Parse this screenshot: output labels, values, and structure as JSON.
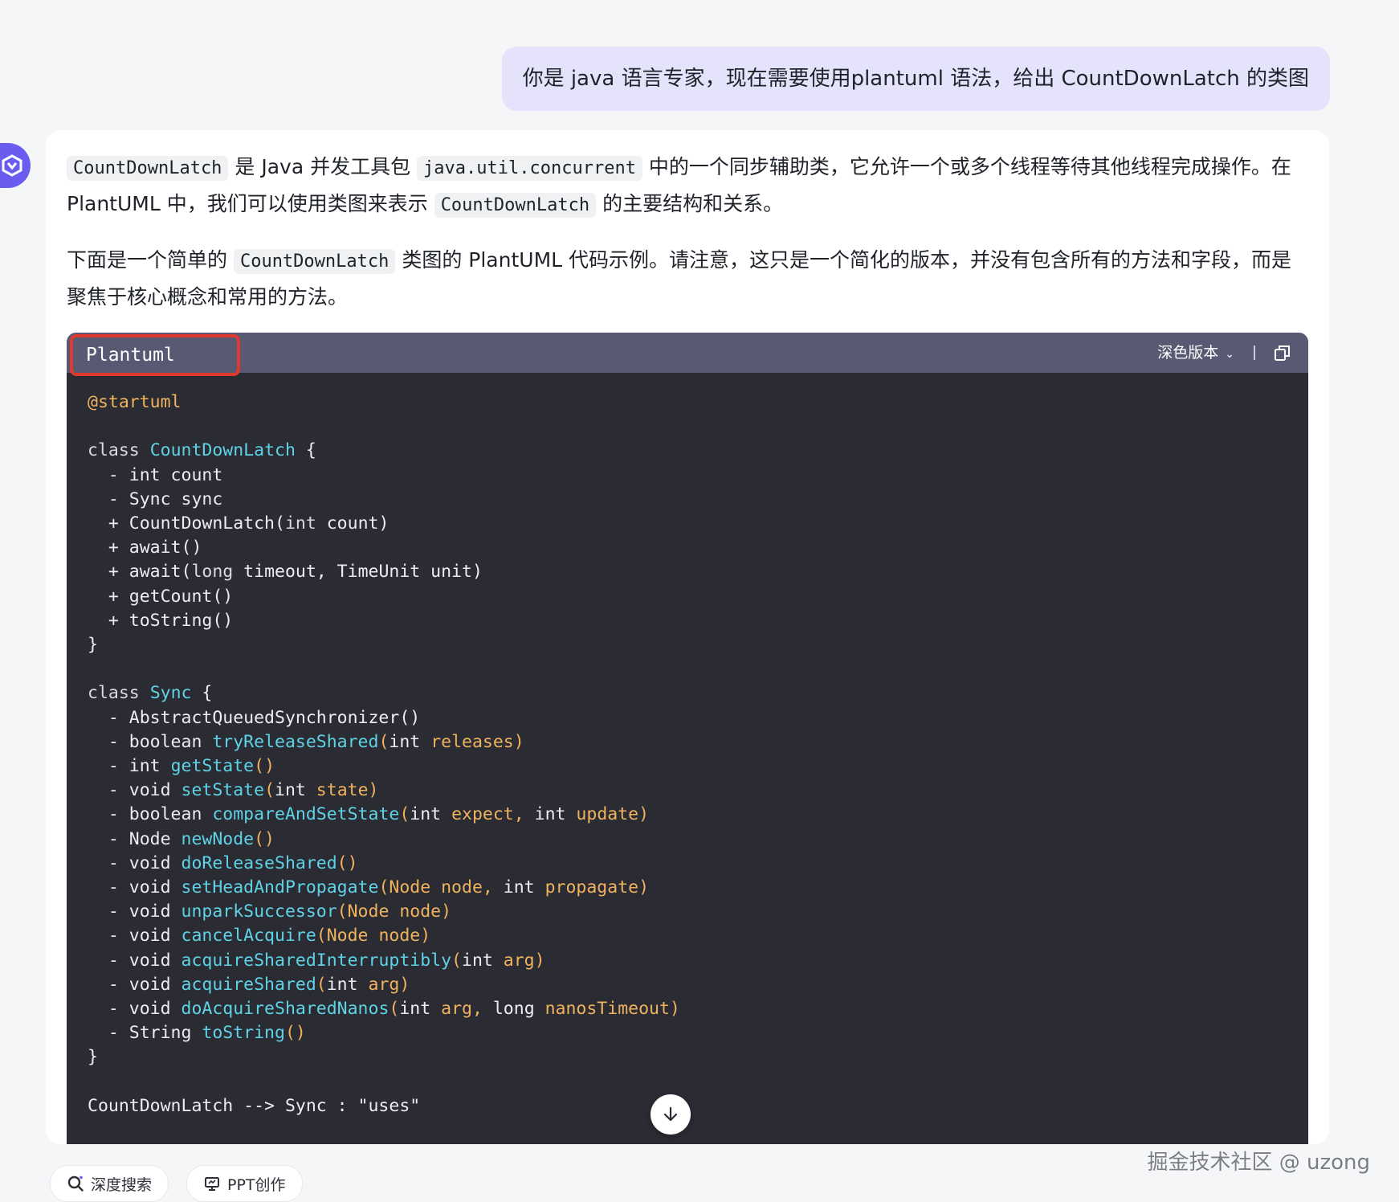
{
  "user_message": "你是 java 语言专家，现在需要使用plantuml 语法，给出 CountDownLatch 的类图",
  "answer": {
    "para1": {
      "code1": "CountDownLatch",
      "text1": " 是 Java 并发工具包 ",
      "code2": "java.util.concurrent",
      "text2": " 中的一个同步辅助类，它允许一个或多个线程等待其他线程完成操作。在 PlantUML 中，我们可以使用类图来表示 ",
      "code3": "CountDownLatch",
      "text3": " 的主要结构和关系。"
    },
    "para2": {
      "text1": "下面是一个简单的 ",
      "code1": "CountDownLatch",
      "text2": " 类图的 PlantUML 代码示例。请注意，这只是一个简化的版本，并没有包含所有的方法和字段，而是聚焦于核心概念和常用的方法。"
    }
  },
  "code_block": {
    "language": "Plantuml",
    "theme_label": "深色版本",
    "lines": {
      "startuml": "@startuml",
      "kw_class": "class",
      "cdl_name": "CountDownLatch",
      "sync_name": "Sync",
      "open_brace": " {",
      "close_brace": "}",
      "l_int_count": "  - int count",
      "l_sync_sync": "  - Sync sync",
      "l_ctor_a": "  + CountDownLatch(",
      "l_ctor_int": "int",
      "l_ctor_b": " count)",
      "l_await": "  + await()",
      "l_await2_a": "  + await(",
      "l_await2_long": "long",
      "l_await2_b": " timeout, TimeUnit unit)",
      "l_getcount": "  + getCount()",
      "l_tostring": "  + toString()",
      "s_aqs": "  - AbstractQueuedSynchronizer()",
      "s_trs_ret": "  - boolean ",
      "s_trs_fn": "tryReleaseShared",
      "s_trs_p1": "(",
      "s_trs_type": "int",
      "s_trs_p2": " releases)",
      "s_gs_ret": "  - int ",
      "s_gs_fn": "getState",
      "s_gs_p": "()",
      "s_ss_ret": "  - void ",
      "s_ss_fn": "setState",
      "s_ss_p1": "(",
      "s_ss_type": "int",
      "s_ss_p2": " state)",
      "s_cas_ret": "  - boolean ",
      "s_cas_fn": "compareAndSetState",
      "s_cas_p1": "(",
      "s_cas_t1": "int",
      "s_cas_p2": " expect, ",
      "s_cas_t2": "int",
      "s_cas_p3": " update)",
      "s_nn_ret": "  - Node ",
      "s_nn_fn": "newNode",
      "s_nn_p": "()",
      "s_drs_ret": "  - void ",
      "s_drs_fn": "doReleaseShared",
      "s_drs_p": "()",
      "s_shp_ret": "  - void ",
      "s_shp_fn": "setHeadAndPropagate",
      "s_shp_p1": "(Node node, ",
      "s_shp_t": "int",
      "s_shp_p2": " propagate)",
      "s_us_ret": "  - void ",
      "s_us_fn": "unparkSuccessor",
      "s_us_p": "(Node node)",
      "s_ca_ret": "  - void ",
      "s_ca_fn": "cancelAcquire",
      "s_ca_p": "(Node node)",
      "s_asi_ret": "  - void ",
      "s_asi_fn": "acquireSharedInterruptibly",
      "s_asi_p1": "(",
      "s_asi_t": "int",
      "s_asi_p2": " arg)",
      "s_as_ret": "  - void ",
      "s_as_fn": "acquireShared",
      "s_as_p1": "(",
      "s_as_t": "int",
      "s_as_p2": " arg)",
      "s_dasn_ret": "  - void ",
      "s_dasn_fn": "doAcquireSharedNanos",
      "s_dasn_p1": "(",
      "s_dasn_t1": "int",
      "s_dasn_p2": " arg, ",
      "s_dasn_t2": "long",
      "s_dasn_p3": " nanosTimeout)",
      "s_ts_ret": "  - String ",
      "s_ts_fn": "toString",
      "s_ts_p": "()",
      "relation": "CountDownLatch --> Sync : \"uses\""
    }
  },
  "bottom_actions": {
    "deep_search": "深度搜索",
    "ppt": "PPT创作"
  },
  "watermark": "掘金技术社区 @ uzong",
  "colors": {
    "user_bubble": "#e4e3fb",
    "code_bg": "#2b2b33",
    "code_header": "#575a72",
    "highlight_border": "#e03a2f",
    "cyan": "#5fd3e6",
    "orange": "#f0b35d"
  }
}
